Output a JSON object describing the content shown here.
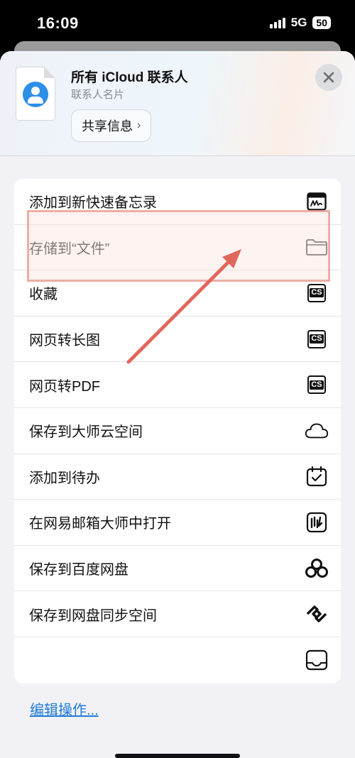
{
  "status_bar": {
    "time": "16:09",
    "network": "5G",
    "battery": "50"
  },
  "header": {
    "title": "所有 iCloud 联系人",
    "subtitle": "联系人名片",
    "share_button": "共享信息",
    "close_icon": "close-icon"
  },
  "actions": [
    {
      "label": "添加到新快速备忘录",
      "icon": "quick-note-icon"
    },
    {
      "label": "存储到“文件”",
      "icon": "folder-icon"
    },
    {
      "label": "收藏",
      "icon": "cs-icon"
    },
    {
      "label": "网页转长图",
      "icon": "cs-icon"
    },
    {
      "label": "网页转PDF",
      "icon": "cs-icon"
    },
    {
      "label": "保存到大师云空间",
      "icon": "cloud-icon"
    },
    {
      "label": "添加到待办",
      "icon": "calendar-check-icon"
    },
    {
      "label": "在网易邮箱大师中打开",
      "icon": "mail-master-icon"
    },
    {
      "label": "保存到百度网盘",
      "icon": "baidu-netdisk-icon"
    },
    {
      "label": "保存到网盘同步空间",
      "icon": "sync-space-icon"
    },
    {
      "label": "",
      "icon": "tray-icon"
    }
  ],
  "cs_text": "CS",
  "edit_actions": "编辑操作...",
  "colors": {
    "accent": "#1f7bd8",
    "highlight": "#e8968c",
    "arrow": "#e0675c",
    "contact_icon": "#2b8fe8"
  }
}
